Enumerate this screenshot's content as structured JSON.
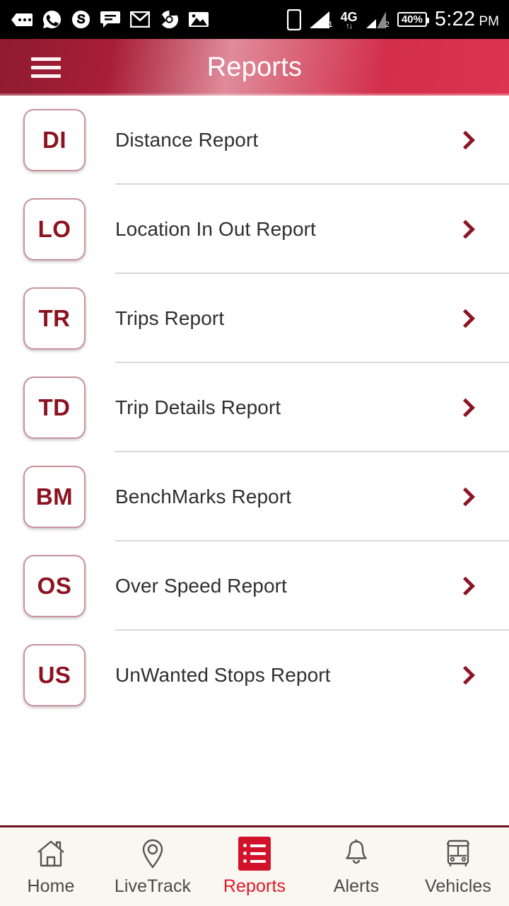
{
  "status_bar": {
    "time": "5:22",
    "meridiem": "PM",
    "battery": "40%",
    "network": "4G",
    "sim1_label": "1",
    "sim2_label": "2",
    "icons": [
      "messages-icon",
      "whatsapp-icon",
      "skype-icon",
      "chat-icon",
      "gmail-icon",
      "chrome-icon",
      "gallery-icon",
      "sim-card-icon",
      "signal-bars-1-icon",
      "signal-bars-2-icon",
      "battery-icon"
    ]
  },
  "header": {
    "title": "Reports",
    "menu_icon": "hamburger-menu-icon",
    "gradient_start": "#8e1b30",
    "gradient_end": "#dc3350"
  },
  "theme": {
    "accent": "#d2112a",
    "maroon": "#8b1220",
    "badge_border": "#c9929e",
    "nav_background": "#faf7f0",
    "label_color": "#2f2f2f"
  },
  "reports": [
    {
      "code": "DI",
      "label": "Distance Report",
      "chevron": "chevron-right-icon"
    },
    {
      "code": "LO",
      "label": "Location In Out Report",
      "chevron": "chevron-right-icon"
    },
    {
      "code": "TR",
      "label": "Trips Report",
      "chevron": "chevron-right-icon"
    },
    {
      "code": "TD",
      "label": "Trip Details Report",
      "chevron": "chevron-right-icon"
    },
    {
      "code": "BM",
      "label": "BenchMarks Report",
      "chevron": "chevron-right-icon"
    },
    {
      "code": "OS",
      "label": "Over Speed Report",
      "chevron": "chevron-right-icon"
    },
    {
      "code": "US",
      "label": "UnWanted Stops Report",
      "chevron": "chevron-right-icon"
    }
  ],
  "bottom_nav": {
    "active": "Reports",
    "items": [
      {
        "label": "Home",
        "icon": "home-icon"
      },
      {
        "label": "LiveTrack",
        "icon": "map-pin-icon"
      },
      {
        "label": "Reports",
        "icon": "report-list-icon"
      },
      {
        "label": "Alerts",
        "icon": "bell-icon"
      },
      {
        "label": "Vehicles",
        "icon": "bus-icon"
      }
    ]
  }
}
